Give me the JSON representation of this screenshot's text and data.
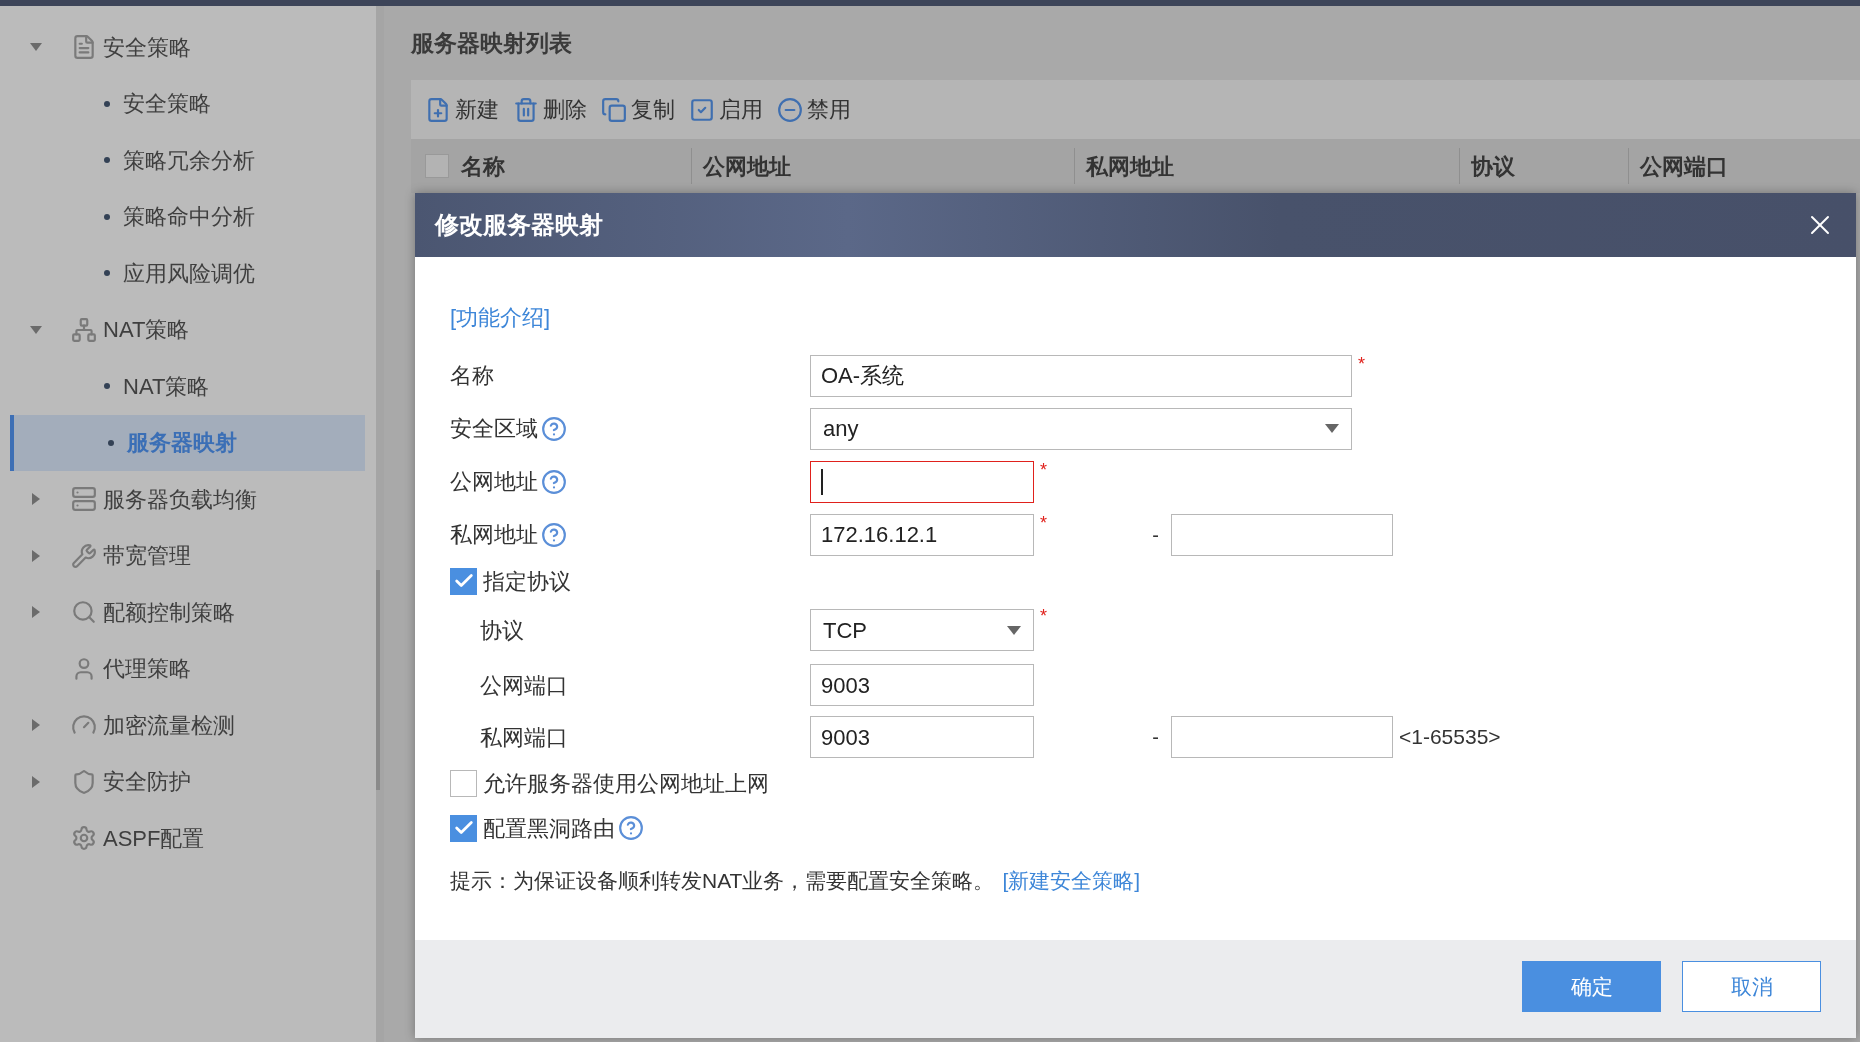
{
  "sidebar": {
    "items": [
      {
        "label": "安全策略",
        "kind": "group",
        "expanded": true,
        "selected": false,
        "children": [
          {
            "label": "安全策略",
            "selected": false
          },
          {
            "label": "策略冗余分析",
            "selected": false
          },
          {
            "label": "策略命中分析",
            "selected": false
          },
          {
            "label": "应用风险调优",
            "selected": false
          }
        ]
      },
      {
        "label": "NAT策略",
        "kind": "group",
        "expanded": true,
        "selected": false,
        "children": [
          {
            "label": "NAT策略",
            "selected": false
          },
          {
            "label": "服务器映射",
            "selected": true
          }
        ]
      },
      {
        "label": "服务器负载均衡",
        "kind": "group",
        "expanded": false,
        "selected": false
      },
      {
        "label": "带宽管理",
        "kind": "group",
        "expanded": false,
        "selected": false
      },
      {
        "label": "配额控制策略",
        "kind": "group",
        "expanded": false,
        "selected": false
      },
      {
        "label": "代理策略",
        "kind": "leaf",
        "selected": false
      },
      {
        "label": "加密流量检测",
        "kind": "group",
        "expanded": false,
        "selected": false
      },
      {
        "label": "安全防护",
        "kind": "group",
        "expanded": false,
        "selected": false
      },
      {
        "label": "ASPF配置",
        "kind": "leaf",
        "selected": false
      }
    ]
  },
  "main": {
    "title": "服务器映射列表",
    "toolbar": [
      "新建",
      "删除",
      "复制",
      "启用",
      "禁用"
    ],
    "table": {
      "select_all_checked": false,
      "columns": [
        "名称",
        "公网地址",
        "私网地址",
        "协议",
        "公网端口"
      ]
    }
  },
  "dialog": {
    "title": "修改服务器映射",
    "intro_link": "[功能介绍]",
    "name": {
      "label": "名称",
      "value": "OA-系统",
      "required_mark": "*"
    },
    "zone": {
      "label": "安全区域",
      "value": "any",
      "help": true
    },
    "public_address": {
      "label": "公网地址",
      "help": true,
      "required_mark": "*",
      "error": true,
      "focused": true
    },
    "private_address": {
      "label": "私网地址",
      "help": true,
      "value": "172.16.12.1",
      "required_mark": "*",
      "range_separator": "-"
    },
    "specify_protocol": {
      "label": "指定协议",
      "checked": true
    },
    "protocol": {
      "label": "协议",
      "value": "TCP",
      "required_mark": "*"
    },
    "public_port": {
      "label": "公网端口",
      "value": "9003"
    },
    "private_port": {
      "label": "私网端口",
      "value": "9003",
      "range_separator": "-",
      "range_hint": "<1-65535>"
    },
    "allow_internet": {
      "label": "允许服务器使用公网地址上网",
      "checked": false
    },
    "blackhole_route": {
      "label": "配置黑洞路由",
      "checked": true,
      "help": true
    },
    "tip": {
      "text": "提示：为保证设备顺利转发NAT业务，需要配置安全策略。",
      "link": "[新建安全策略]"
    },
    "buttons": [
      {
        "label": "确定",
        "kind": "primary"
      },
      {
        "label": "取消",
        "kind": "secondary"
      }
    ]
  }
}
